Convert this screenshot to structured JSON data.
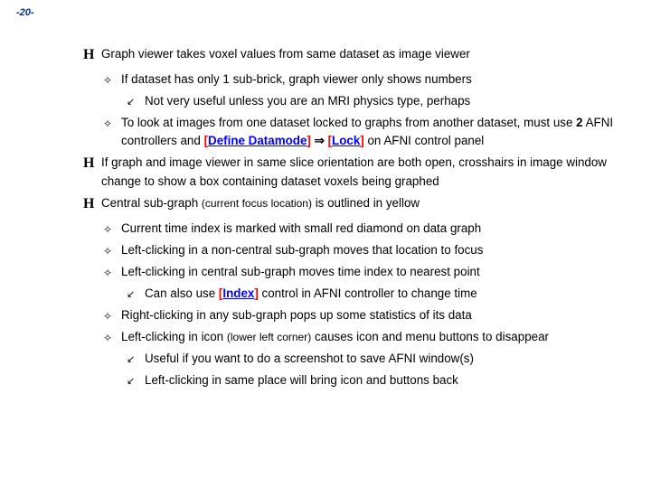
{
  "pageNumber": "-20-",
  "t1": "Graph viewer takes voxel values from same dataset as image viewer",
  "t1a": "If dataset has only 1 sub-brick, graph viewer only shows numbers",
  "t1a1": "Not very useful unless you are an MRI physics type, perhaps",
  "t1b_pre": "To look at images from one dataset locked to graphs from another dataset, must use ",
  "t1b_bold": "2",
  "t1b_mid": " AFNI controllers and ",
  "cmd1": "Define Datamode",
  "t1b_arrow": " ⇒ ",
  "cmd2": "Lock",
  "t1b_post": " on AFNI control panel",
  "t2": "If graph and image viewer in same slice orientation are both open, crosshairs in image window change to show a box containing dataset voxels being graphed",
  "t3_pre": "Central sub-graph ",
  "t3_paren": "(current focus location)",
  "t3_post": " is outlined in yellow",
  "t3a": "Current time index is marked with small red diamond on data graph",
  "t3b": "Left-clicking in a non-central sub-graph moves that location to focus",
  "t3c": "Left-clicking in central sub-graph moves time index to nearest point",
  "t3c1_pre": "Can also use ",
  "cmd3": "Index",
  "t3c1_post": " control in AFNI controller to change time",
  "t3d": "Right-clicking in any sub-graph pops up some statistics of its data",
  "t3e_pre": "Left-clicking in icon ",
  "t3e_paren": "(lower left corner)",
  "t3e_post": " causes icon and menu buttons to disappear",
  "t3e1": "Useful if you want to do a screenshot to save AFNI window(s)",
  "t3e2": "Left-clicking in same place will bring icon and buttons back",
  "br_open": "[",
  "br_close": "]",
  "bulH": "H",
  "bulDiamond": "✧",
  "bulArrow": "↙"
}
